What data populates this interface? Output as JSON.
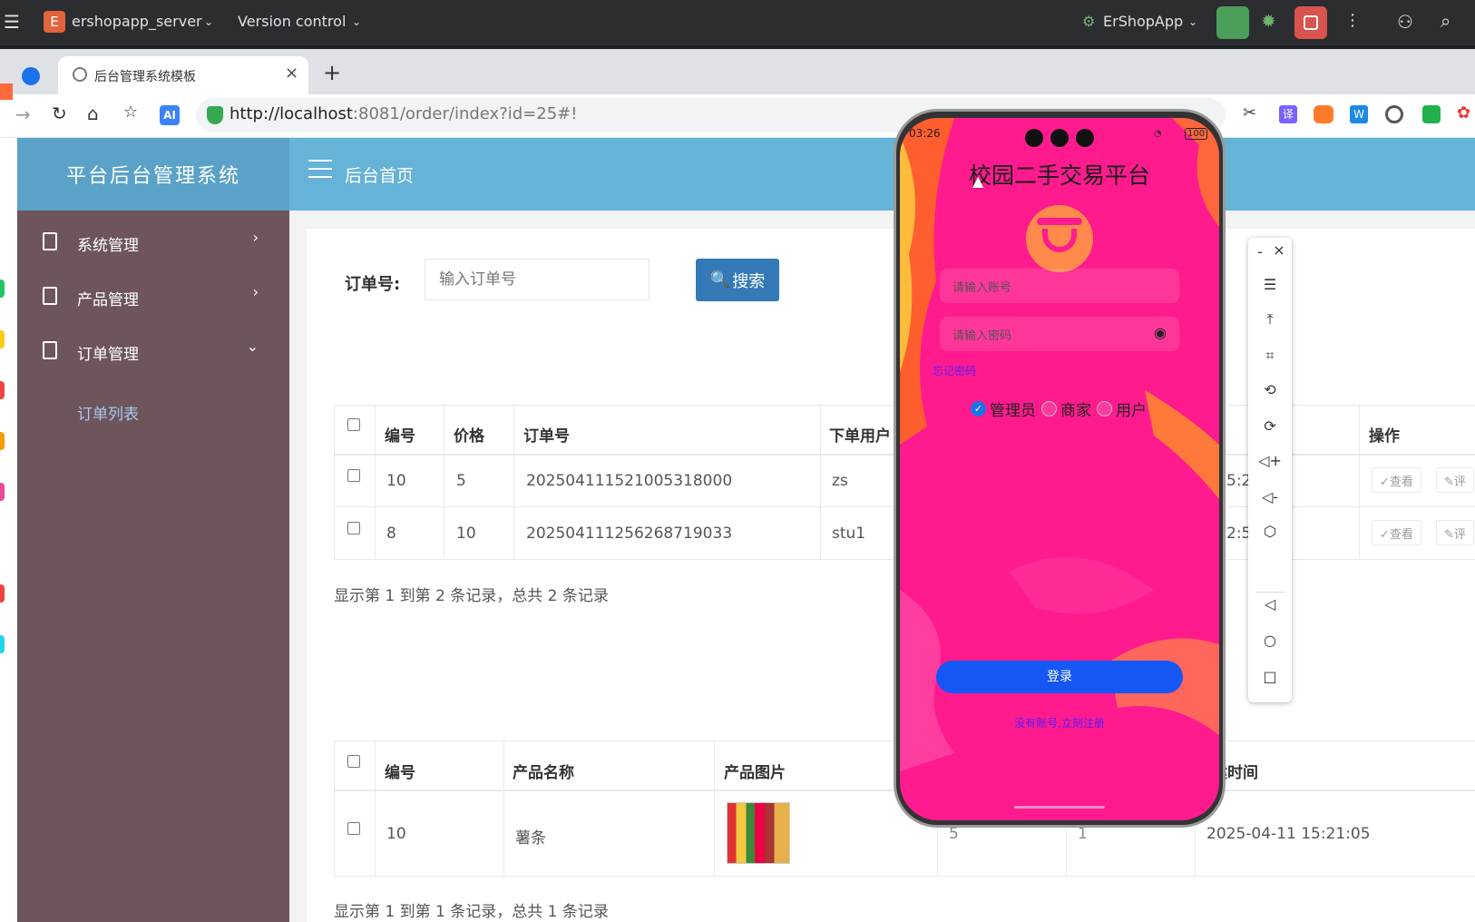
{
  "ide": {
    "project_badge": "E",
    "project_name": "ershopapp_server",
    "vcs": "Version control",
    "run_config": "ErShopApp",
    "colors": {
      "bar": "#2b2d30",
      "badge": "#e0643c",
      "run": "#4b9f5a",
      "stop": "#d9534f"
    }
  },
  "browser": {
    "tab_title": "后台管理系统模板",
    "new_tab": "+",
    "close_tab": "×",
    "url_host": "http://localhost",
    "url_rest": ":8081/order/index?id=25#!",
    "ai_badge": "AI",
    "ext_translate": "译",
    "ext_w": "W"
  },
  "admin": {
    "brand": "平台后台管理系统",
    "header_title": "后台首页",
    "menu": [
      {
        "label": "系统管理",
        "arrow": "›"
      },
      {
        "label": "产品管理",
        "arrow": "›"
      },
      {
        "label": "订单管理",
        "arrow": "⌄"
      }
    ],
    "submenu": "订单列表",
    "search": {
      "label": "订单号:",
      "placeholder": "输入订单号",
      "button": "搜索"
    },
    "orders": {
      "headers": [
        "编号",
        "价格",
        "订单号",
        "下单用户",
        "操作"
      ],
      "rows": [
        {
          "id": "10",
          "price": "5",
          "order_no": "20250411152100531800​0",
          "user": "zs",
          "time": "5:21",
          "view": "✓查看",
          "rate": "✎评"
        },
        {
          "id": "8",
          "price": "10",
          "order_no": "20250411125626871903​3",
          "user": "stu1",
          "time": "2:56",
          "view": "✓查看",
          "rate": "✎评"
        }
      ],
      "footer": "显示第 1 到第 2 条记录，总共 2 条记录"
    },
    "products": {
      "headers": [
        "编号",
        "产品名称",
        "产品图片",
        "建时间"
      ],
      "rows": [
        {
          "id": "10",
          "name": "薯条",
          "qty": "5",
          "count": "1",
          "time": "2025-04-11 15:21:05"
        }
      ],
      "footer": "显示第 1 到第 1 条记录，总共 1 条记录"
    },
    "colors": {
      "header": "#65b3d6",
      "sidebar": "#6d555b",
      "search_btn": "#337ab7",
      "submenu": "#a8c7ef"
    }
  },
  "phone": {
    "time": "03:26",
    "battery": "100",
    "title": "校园二手交易平台",
    "account_placeholder": "请输入账号",
    "password_placeholder": "请输入密码",
    "forgot": "忘记密码",
    "roles": [
      "管理员",
      "商家",
      "用户"
    ],
    "login": "登录",
    "register": "没有账号,立刻注册",
    "colors": {
      "bg": "#ff1b8d",
      "button": "#1557f5",
      "link": "#5b1cff",
      "logo": "#ff8a4c"
    }
  },
  "emulator": {
    "min": "-",
    "close": "×",
    "menu": "☰",
    "top": "⤒",
    "crop": "⌗",
    "rot_l": "⟲",
    "rot_r": "⟳",
    "vol_up": "◁+",
    "vol_dn": "◁-",
    "shake": "⬡",
    "back": "◁",
    "home": "○",
    "recent": "□"
  }
}
